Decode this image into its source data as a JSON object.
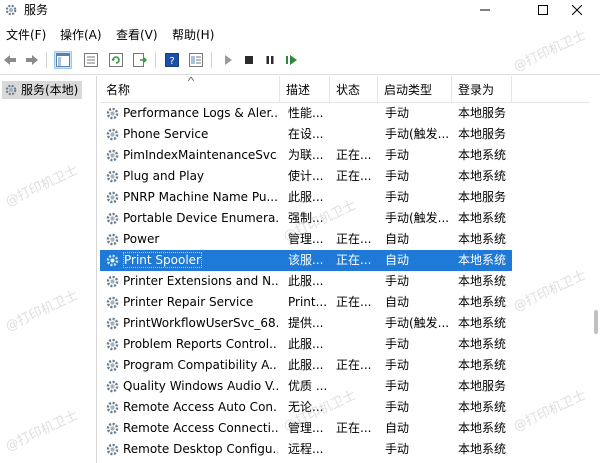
{
  "window": {
    "title": "服务",
    "minimize_icon": "minimize-icon",
    "maximize_icon": "maximize-icon",
    "close_icon": "close-icon"
  },
  "menu": [
    "文件(F)",
    "操作(A)",
    "查看(V)",
    "帮助(H)"
  ],
  "toolbar": {
    "icons": [
      "back-arrow-icon",
      "forward-arrow-icon",
      "console-tree-icon",
      "properties-list-icon",
      "refresh-icon",
      "export-list-icon",
      "help-icon",
      "details-view-icon",
      "play-icon",
      "stop-icon",
      "pause-icon",
      "restart-icon"
    ]
  },
  "tree": {
    "root_label": "服务(本地)"
  },
  "columns": [
    "名称",
    "描述",
    "状态",
    "启动类型",
    "登录为"
  ],
  "services": [
    {
      "name": "Performance Logs & Aler...",
      "desc": "性能...",
      "status": "",
      "start": "手动",
      "logon": "本地服务"
    },
    {
      "name": "Phone Service",
      "desc": "在设...",
      "status": "",
      "start": "手动(触发...",
      "logon": "本地服务"
    },
    {
      "name": "PimIndexMaintenanceSvc...",
      "desc": "为联...",
      "status": "正在...",
      "start": "手动",
      "logon": "本地系统"
    },
    {
      "name": "Plug and Play",
      "desc": "使计...",
      "status": "正在...",
      "start": "手动",
      "logon": "本地系统"
    },
    {
      "name": "PNRP Machine Name Pu...",
      "desc": "此服...",
      "status": "",
      "start": "手动",
      "logon": "本地服务"
    },
    {
      "name": "Portable Device Enumera...",
      "desc": "强制...",
      "status": "",
      "start": "手动(触发...",
      "logon": "本地系统"
    },
    {
      "name": "Power",
      "desc": "管理...",
      "status": "正在...",
      "start": "自动",
      "logon": "本地系统"
    },
    {
      "name": "Print Spooler",
      "desc": "该服...",
      "status": "正在...",
      "start": "自动",
      "logon": "本地系统",
      "selected": true
    },
    {
      "name": "Printer Extensions and N...",
      "desc": "此服...",
      "status": "",
      "start": "手动",
      "logon": "本地系统"
    },
    {
      "name": "Printer Repair Service",
      "desc": "Print...",
      "status": "正在...",
      "start": "自动",
      "logon": "本地系统"
    },
    {
      "name": "PrintWorkflowUserSvc_68...",
      "desc": "提供...",
      "status": "",
      "start": "手动(触发...",
      "logon": "本地系统"
    },
    {
      "name": "Problem Reports Control...",
      "desc": "此服...",
      "status": "",
      "start": "手动",
      "logon": "本地系统"
    },
    {
      "name": "Program Compatibility A...",
      "desc": "此服...",
      "status": "正在...",
      "start": "手动",
      "logon": "本地系统"
    },
    {
      "name": "Quality Windows Audio V...",
      "desc": "优质 ...",
      "status": "",
      "start": "手动",
      "logon": "本地服务"
    },
    {
      "name": "Remote Access Auto Con...",
      "desc": "无论...",
      "status": "",
      "start": "手动",
      "logon": "本地系统"
    },
    {
      "name": "Remote Access Connecti...",
      "desc": "管理...",
      "status": "正在...",
      "start": "自动",
      "logon": "本地系统"
    },
    {
      "name": "Remote Desktop Configu...",
      "desc": "远程...",
      "status": "",
      "start": "手动",
      "logon": "本地系统"
    }
  ],
  "watermark": "@打印机卫士",
  "colors": {
    "selection": "#1e79d7",
    "tree_selection": "#d9d9d9"
  }
}
